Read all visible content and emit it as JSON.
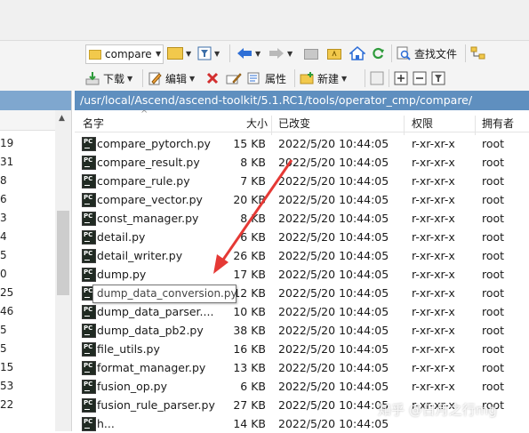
{
  "toolbar1": {
    "path_combo_value": "compare",
    "find_files_label": "查找文件"
  },
  "toolbar2": {
    "download_label": "下载",
    "edit_label": "编辑",
    "properties_label": "属性",
    "new_label": "新建"
  },
  "left_panel": {
    "items": [
      "19",
      "31",
      "8",
      "6",
      "3",
      "4",
      "5",
      "0",
      "25",
      "46",
      "5",
      "5",
      "15",
      "53",
      "22"
    ]
  },
  "path_bar": {
    "path": "/usr/local/Ascend/ascend-toolkit/5.1.RC1/tools/operator_cmp/compare/"
  },
  "columns": {
    "name": "名字",
    "size": "大小",
    "modified": "已改变",
    "permissions": "权限",
    "owner": "拥有者"
  },
  "files": [
    {
      "name": "compare_pytorch.py",
      "size": "15 KB",
      "modified": "2022/5/20 10:44:05",
      "permissions": "r-xr-xr-x",
      "owner": "root"
    },
    {
      "name": "compare_result.py",
      "size": "8 KB",
      "modified": "2022/5/20 10:44:05",
      "permissions": "r-xr-xr-x",
      "owner": "root"
    },
    {
      "name": "compare_rule.py",
      "size": "7 KB",
      "modified": "2022/5/20 10:44:05",
      "permissions": "r-xr-xr-x",
      "owner": "root"
    },
    {
      "name": "compare_vector.py",
      "size": "20 KB",
      "modified": "2022/5/20 10:44:05",
      "permissions": "r-xr-xr-x",
      "owner": "root"
    },
    {
      "name": "const_manager.py",
      "size": "8 KB",
      "modified": "2022/5/20 10:44:05",
      "permissions": "r-xr-xr-x",
      "owner": "root"
    },
    {
      "name": "detail.py",
      "size": "6 KB",
      "modified": "2022/5/20 10:44:05",
      "permissions": "r-xr-xr-x",
      "owner": "root"
    },
    {
      "name": "detail_writer.py",
      "size": "26 KB",
      "modified": "2022/5/20 10:44:05",
      "permissions": "r-xr-xr-x",
      "owner": "root"
    },
    {
      "name": "dump.py",
      "size": "17 KB",
      "modified": "2022/5/20 10:44:05",
      "permissions": "r-xr-xr-x",
      "owner": "root"
    },
    {
      "name": "",
      "size": "12 KB",
      "modified": "2022/5/20 10:44:05",
      "permissions": "r-xr-xr-x",
      "owner": "root"
    },
    {
      "name": "dump_data_parser....",
      "size": "10 KB",
      "modified": "2022/5/20 10:44:05",
      "permissions": "r-xr-xr-x",
      "owner": "root"
    },
    {
      "name": "dump_data_pb2.py",
      "size": "38 KB",
      "modified": "2022/5/20 10:44:05",
      "permissions": "r-xr-xr-x",
      "owner": "root"
    },
    {
      "name": "file_utils.py",
      "size": "16 KB",
      "modified": "2022/5/20 10:44:05",
      "permissions": "r-xr-xr-x",
      "owner": "root"
    },
    {
      "name": "format_manager.py",
      "size": "13 KB",
      "modified": "2022/5/20 10:44:05",
      "permissions": "r-xr-xr-x",
      "owner": "root"
    },
    {
      "name": "fusion_op.py",
      "size": "6 KB",
      "modified": "2022/5/20 10:44:05",
      "permissions": "r-xr-xr-x",
      "owner": "root"
    },
    {
      "name": "fusion_rule_parser.py",
      "size": "27 KB",
      "modified": "2022/5/20 10:44:05",
      "permissions": "r-xr-xr-x",
      "owner": "root"
    },
    {
      "name": "h...",
      "size": "14 KB",
      "modified": "2022/5/20 10:44:05",
      "permissions": "",
      "owner": ""
    }
  ],
  "tooltip": {
    "text": "dump_data_conversion.py"
  },
  "watermark": {
    "text": "知乎 @日月之行mg"
  },
  "colors": {
    "path_bar": "#5f8fbf",
    "annotation_arrow": "#e53935"
  }
}
